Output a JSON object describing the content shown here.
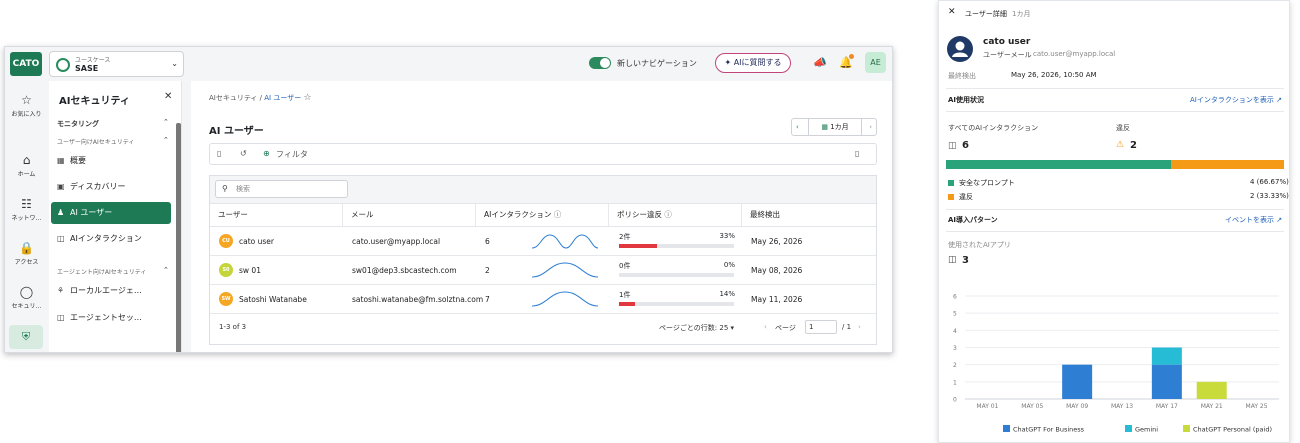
{
  "topbar": {
    "logo": "CATO",
    "usecase_label": "ユースケース",
    "usecase_value": "SASE",
    "new_nav_label": "新しいナビゲーション",
    "ai_ask_label": "AIに質問する",
    "avatar_initials": "AE"
  },
  "rail": {
    "items": [
      {
        "label": "お気に入り",
        "icon": "star-icon"
      },
      {
        "label": "ホーム",
        "icon": "home-icon"
      },
      {
        "label": "ネットワ…",
        "icon": "network-icon"
      },
      {
        "label": "アクセス",
        "icon": "lock-icon"
      },
      {
        "label": "セキュリ…",
        "icon": "shield-icon"
      },
      {
        "label": "",
        "icon": "ai-shield-icon"
      }
    ]
  },
  "side": {
    "title": "AIセキュリティ",
    "section_monitoring": "モニタリング",
    "sub_user_ai": "ユーザー向けAIセキュリティ",
    "items": [
      {
        "label": "概要",
        "icon": "grid-icon"
      },
      {
        "label": "ディスカバリー",
        "icon": "discovery-icon"
      },
      {
        "label": "AI ユーザー",
        "icon": "users-icon"
      },
      {
        "label": "AIインタラクション",
        "icon": "chat-icon"
      }
    ],
    "sub_agent_ai": "エージェント向けAIセキュリティ",
    "agent_items": [
      {
        "label": "ローカルエージェ…",
        "icon": "robot-icon"
      },
      {
        "label": "エージェントセッ…",
        "icon": "session-icon"
      }
    ]
  },
  "content": {
    "breadcrumb_root": "AIセキュリティ",
    "breadcrumb_current": "AI ユーザー",
    "page_title": "AI ユーザー",
    "range_label": "1カ月",
    "filter_label": "フィルタ",
    "search_placeholder": "検索",
    "columns": [
      "ユーザー",
      "メール",
      "AIインタラクション",
      "ポリシー違反",
      "最終検出"
    ],
    "rows": [
      {
        "initials": "CU",
        "badge_color": "#f5a623",
        "user": "cato user",
        "email": "cato.user@myapp.local",
        "interactions": "6",
        "violations": "2件",
        "pct": "33%",
        "pct_value": 33,
        "last_seen": "May 26, 2026"
      },
      {
        "initials": "S0",
        "badge_color": "#c4d43a",
        "user": "sw 01",
        "email": "sw01@dep3.sbcastech.com",
        "interactions": "2",
        "violations": "0件",
        "pct": "0%",
        "pct_value": 0,
        "last_seen": "May 08, 2026"
      },
      {
        "initials": "SW",
        "badge_color": "#f5a623",
        "user": "Satoshi Watanabe",
        "email": "satoshi.watanabe@fm.solztna.com",
        "interactions": "7",
        "violations": "1件",
        "pct": "14%",
        "pct_value": 14,
        "last_seen": "May 11, 2026"
      }
    ],
    "pagination": {
      "range_text": "1-3 of 3",
      "rows_per_page_label": "ページごとの行数: 25",
      "page_label": "ページ",
      "page_value": "1",
      "page_total": "/ 1"
    }
  },
  "detail": {
    "header_title": "ユーザー詳細",
    "header_period": "1カ月",
    "user_name": "cato user",
    "email_label": "ユーザーメール",
    "email_value": "cato.user@myapp.local",
    "last_seen_label": "最終検出",
    "last_seen_value": "May 26, 2026, 10:50 AM",
    "usage_title": "AI使用状況",
    "usage_link": "AIインタラクションを表示",
    "all_interactions_label": "すべてのAIインタラクション",
    "all_interactions_value": "6",
    "violations_label": "違反",
    "violations_value": "2",
    "safe_label": "安全なプロンプト",
    "safe_value": "4 (66.67%)",
    "safe_fraction": 0.6667,
    "viol_label": "違反",
    "viol_value": "2 (33.33%)",
    "adoption_title": "AI導入パターン",
    "events_link": "イベントを表示",
    "apps_label": "使用されたAIアプリ",
    "apps_value": "3",
    "colors": {
      "safe": "#2ba37a",
      "violation": "#f59a17",
      "accent": "#1e7a55",
      "link": "#1e5fb8"
    }
  },
  "chart_data": {
    "type": "bar",
    "stacked": true,
    "categories": [
      "MAY 01",
      "MAY 05",
      "MAY 09",
      "MAY 13",
      "MAY 17",
      "MAY 21",
      "MAY 25"
    ],
    "yticks": [
      "0",
      "1",
      "2",
      "3",
      "4",
      "5",
      "6"
    ],
    "ylim": [
      0,
      6
    ],
    "series": [
      {
        "name": "ChatGPT For Business",
        "color": "#2e7fd3",
        "values": [
          0,
          0,
          2,
          0,
          2,
          0,
          0
        ]
      },
      {
        "name": "Gemini",
        "color": "#27bcd6",
        "values": [
          0,
          0,
          0,
          0,
          1,
          0,
          0
        ]
      },
      {
        "name": "ChatGPT Personal (paid)",
        "color": "#c8db3a",
        "values": [
          0,
          0,
          0,
          0,
          0,
          1,
          0
        ]
      }
    ],
    "legend_position": "bottom"
  }
}
